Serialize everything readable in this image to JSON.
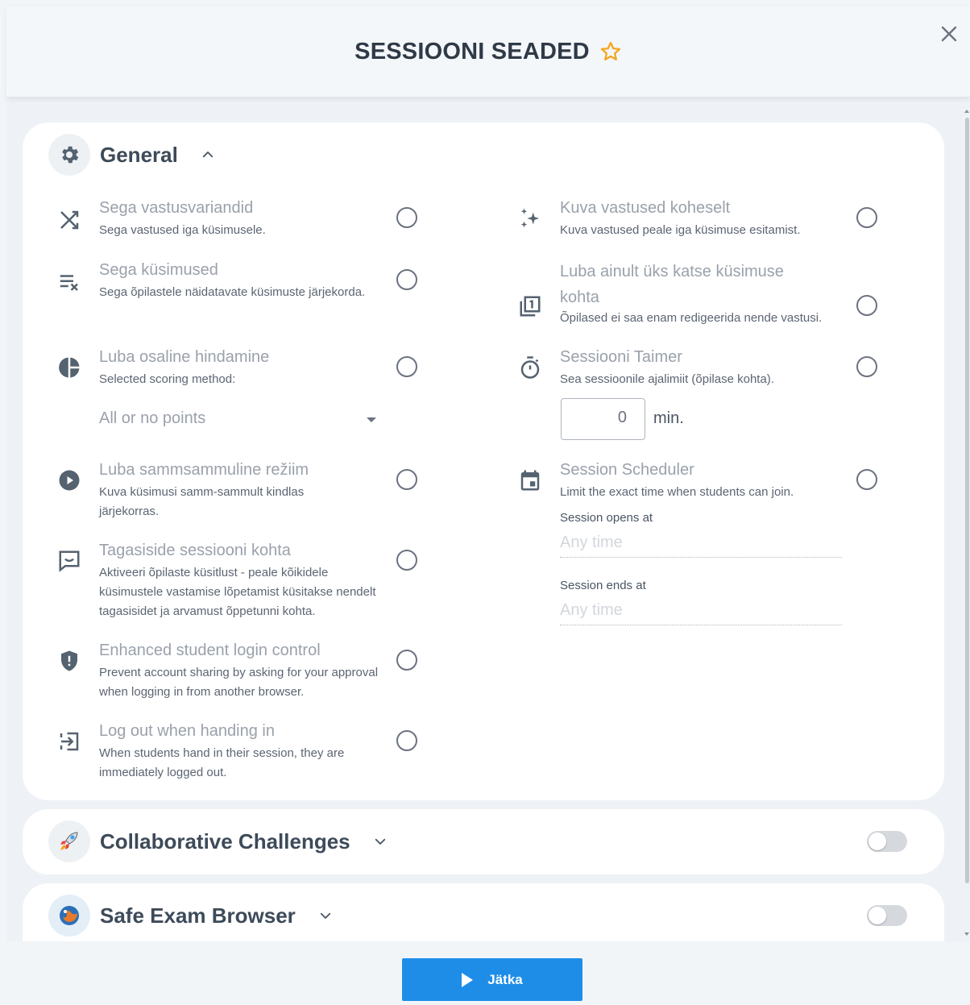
{
  "header": {
    "title": "SESSIOONI SEADED"
  },
  "general": {
    "title": "General",
    "left": [
      {
        "title": "Sega vastusvariandid",
        "desc": "Sega vastused iga küsimusele.",
        "icon": "shuffle-icon"
      },
      {
        "title": "Sega küsimused",
        "desc": "Sega õpilastele näidatavate küsimuste järjekorda.",
        "icon": "clear-list-icon"
      },
      {
        "title": "Luba osaline hindamine",
        "desc": "Selected scoring method:",
        "icon": "pie-chart-icon",
        "select_value": "All or no points"
      },
      {
        "title": "Luba sammsammuline režiim",
        "desc": "Kuva küsimusi samm-sammult kindlas järjekorras.",
        "icon": "play-circle-icon"
      },
      {
        "title": "Tagasiside sessiooni kohta",
        "desc": "Aktiveeri õpilaste küsitlust - peale kõikidele küsimustele vastamise lõpetamist küsitakse nendelt tagasisidet ja arvamust õppetunni kohta.",
        "icon": "feedback-icon"
      },
      {
        "title": "Enhanced student login control",
        "desc": "Prevent account sharing by asking for your approval when logging in from another browser.",
        "icon": "shield-icon"
      },
      {
        "title": "Log out when handing in",
        "desc": "When students hand in their session, they are immediately logged out.",
        "icon": "logout-icon"
      }
    ],
    "right": [
      {
        "title": "Kuva vastused koheselt",
        "desc": "Kuva vastused peale iga küsimuse esitamist.",
        "icon": "sparkle-icon"
      },
      {
        "title": "Luba ainult üks katse küsimuse kohta",
        "desc": "Õpilased ei saa enam redigeerida nende vastusi.",
        "icon": "filter-one-icon"
      },
      {
        "title": "Sessiooni Taimer",
        "desc": "Sea sessioonile ajalimiit (õpilase kohta).",
        "icon": "timer-icon",
        "timer_value": "0",
        "timer_unit": "min."
      },
      {
        "title": "Session Scheduler",
        "desc": "Limit the exact time when students can join.",
        "icon": "calendar-icon",
        "opens_label": "Session opens at",
        "opens_placeholder": "Any time",
        "ends_label": "Session ends at",
        "ends_placeholder": "Any time"
      }
    ]
  },
  "collab": {
    "title": "Collaborative Challenges"
  },
  "seb": {
    "title": "Safe Exam Browser"
  },
  "footer": {
    "continue_label": "Jätka"
  },
  "colors": {
    "accent": "#1d8de8",
    "star": "#f5a623"
  }
}
